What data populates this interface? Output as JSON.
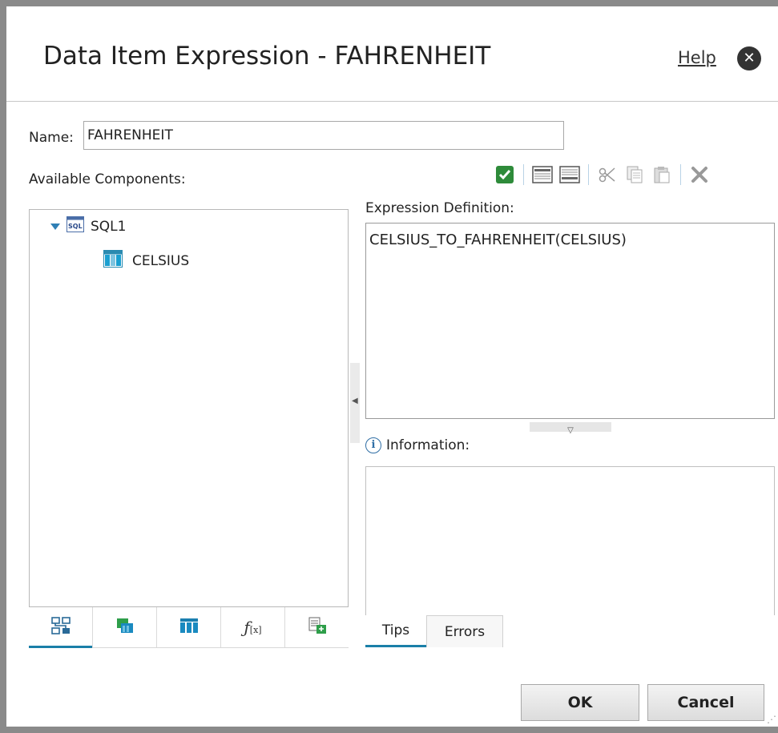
{
  "dialog": {
    "title": "Data Item Expression - FAHRENHEIT",
    "help_label": "Help"
  },
  "name_field": {
    "label": "Name:",
    "value": "FAHRENHEIT"
  },
  "available_components": {
    "label": "Available Components:",
    "tree": {
      "root": {
        "label": "SQL1",
        "icon": "sql-icon",
        "expanded": true
      },
      "children": [
        {
          "label": "CELSIUS",
          "icon": "column-icon"
        }
      ]
    },
    "tabs": [
      {
        "icon": "tree-view-icon",
        "active": true
      },
      {
        "icon": "data-items-icon",
        "active": false
      },
      {
        "icon": "columns-icon",
        "active": false
      },
      {
        "icon": "function-icon",
        "active": false
      },
      {
        "icon": "parameters-icon",
        "active": false
      }
    ]
  },
  "toolbar": {
    "icons": [
      "validate-icon",
      "insert-above-icon",
      "insert-below-icon",
      "cut-icon",
      "copy-icon",
      "paste-icon",
      "delete-icon"
    ]
  },
  "expression": {
    "label": "Expression Definition:",
    "value": "CELSIUS_TO_FAHRENHEIT(CELSIUS)"
  },
  "information": {
    "label": "Information:",
    "tabs": [
      {
        "label": "Tips",
        "active": true
      },
      {
        "label": "Errors",
        "active": false
      }
    ]
  },
  "buttons": {
    "ok": "OK",
    "cancel": "Cancel"
  },
  "colors": {
    "accent": "#1a7fa8",
    "validate": "#2e8b3a",
    "border": "#8a8a8a"
  }
}
